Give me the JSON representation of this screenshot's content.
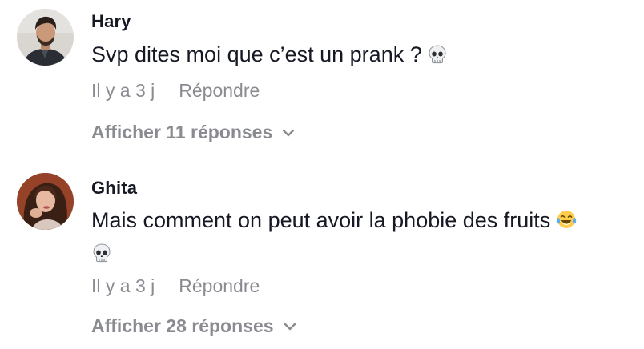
{
  "comments": [
    {
      "username": "Hary",
      "text": "Svp dites moi que c’est un prank ?",
      "emojis": [
        "skull-icon"
      ],
      "time": "Il y a 3 j",
      "reply_label": "Répondre",
      "view_replies": "Afficher 11 réponses"
    },
    {
      "username": "Ghita",
      "text": "Mais comment on peut avoir la phobie des fruits",
      "emojis": [
        "tears-of-joy-icon",
        "skull-icon"
      ],
      "time": "Il y a 3 j",
      "reply_label": "Répondre",
      "view_replies": "Afficher 28 réponses"
    }
  ],
  "colors": {
    "primary_text": "#161823",
    "secondary_text": "#8a8b91",
    "background": "#ffffff"
  }
}
